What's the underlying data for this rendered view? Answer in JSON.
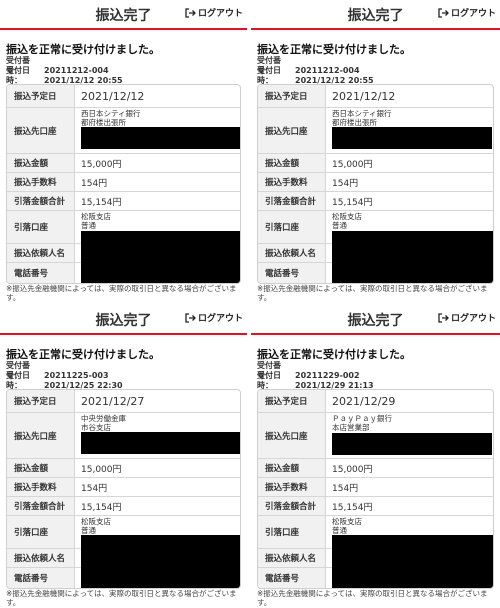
{
  "header": {
    "title": "振込完了",
    "logout_label": "ログアウト"
  },
  "message": "振込を正常に受け付けました。",
  "labels": {
    "receipt_no": "受付番号：",
    "receipt_dt": "受付日時：",
    "scheduled_date": "振込予定日",
    "destination": "振込先口座",
    "amount": "振込金額",
    "fee": "振込手数料",
    "total": "引落金額合計",
    "debit_account": "引落口座",
    "requester": "振込依頼人名",
    "phone": "電話番号"
  },
  "note": "※振込先金融機関によっては、実際の取引日と異なる場合がございます。",
  "screens": [
    {
      "receipt_no": "20211212-004",
      "receipt_dt": "2021/12/12 20:55",
      "scheduled_date": "2021/12/12",
      "bank_name": "西日本シティ銀行",
      "branch_name": "都府楼出張所",
      "amount": "15,000円",
      "fee": "154円",
      "total": "15,154円",
      "debit_branch": "松阪支店",
      "debit_type": "普通"
    },
    {
      "receipt_no": "20211212-004",
      "receipt_dt": "2021/12/12 20:55",
      "scheduled_date": "2021/12/12",
      "bank_name": "西日本シティ銀行",
      "branch_name": "都府楼出張所",
      "amount": "15,000円",
      "fee": "154円",
      "total": "15,154円",
      "debit_branch": "松阪支店",
      "debit_type": "普通"
    },
    {
      "receipt_no": "20211225-003",
      "receipt_dt": "2021/12/25 22:30",
      "scheduled_date": "2021/12/27",
      "bank_name": "中央労働金庫",
      "branch_name": "市谷支店",
      "amount": "15,000円",
      "fee": "154円",
      "total": "15,154円",
      "debit_branch": "松阪支店",
      "debit_type": "普通"
    },
    {
      "receipt_no": "20211229-002",
      "receipt_dt": "2021/12/29 21:13",
      "scheduled_date": "2021/12/29",
      "bank_name": "ＰａｙＰａｙ銀行",
      "branch_name": "本店営業部",
      "amount": "15,000円",
      "fee": "154円",
      "total": "15,154円",
      "debit_branch": "松阪支店",
      "debit_type": "普通"
    }
  ]
}
